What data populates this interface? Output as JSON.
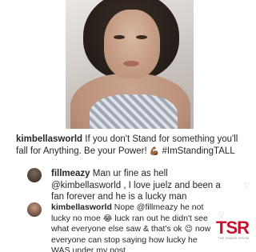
{
  "post": {
    "username": "kimbellasworld",
    "caption_text": " If you don't Stand for something you'll fall for Anything. Be your Power! ",
    "caption_emoji": "💪🏾",
    "caption_hashtag": " #ImStandingTALL"
  },
  "comments": [
    {
      "username": "fillmeazy",
      "text": " Man ur fine as hell @kimbellasworld , I love juelz and been a fan forever and he is a lucky man"
    },
    {
      "username": "kimbellasworld",
      "text_1": " Nope @fillmeazy he not lucky no moe ",
      "emoji_1": "😂",
      "text_2": " luck ran out he didn't see what everyone else saw & that's ok ",
      "emoji_2": "😉",
      "text_3": " now everyone can stop saying how lucky he WAS under my post."
    }
  ],
  "logo": {
    "main": "TSR",
    "sub": "THE SHADE ROOM"
  },
  "icons": {
    "like": "heart-outline-icon"
  },
  "colors": {
    "logo_red": "#c8102e",
    "text": "#262626",
    "heart": "#b8b8b8"
  }
}
